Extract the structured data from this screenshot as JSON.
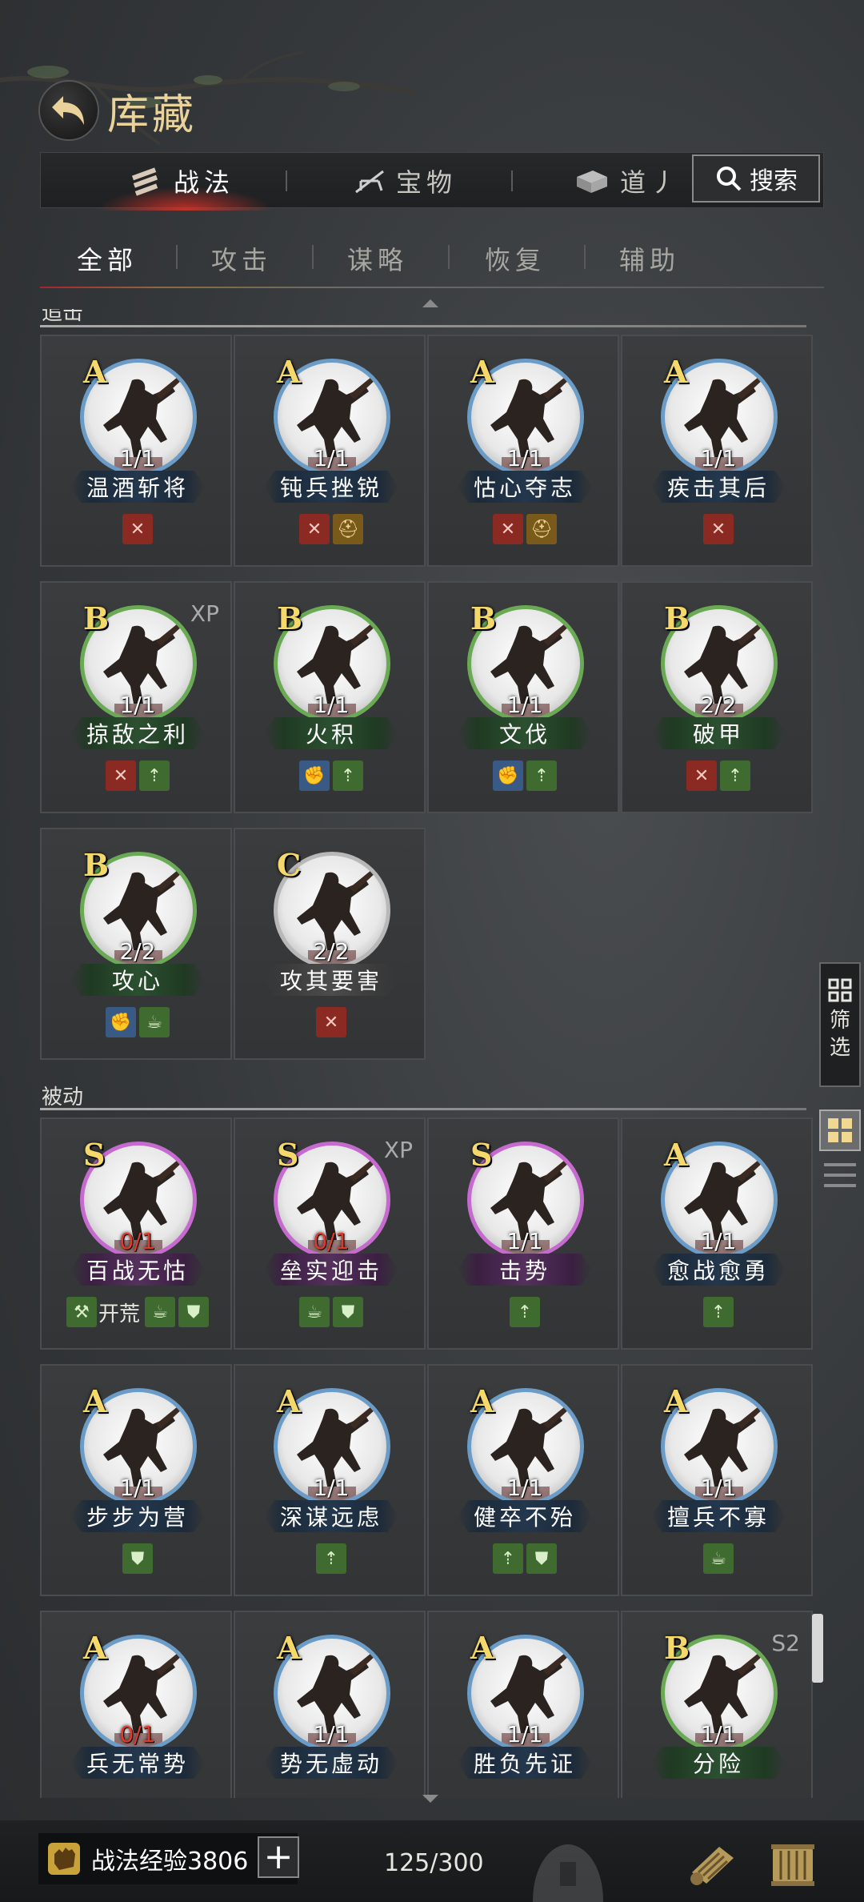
{
  "header": {
    "title": "库藏",
    "back_icon": "back-arrow-icon"
  },
  "top_tabs": [
    {
      "label": "战法",
      "icon": "scroll-icon",
      "active": true
    },
    {
      "label": "宝物",
      "icon": "bow-icon",
      "active": false
    },
    {
      "label": "道丿",
      "icon": "box-icon",
      "active": false
    }
  ],
  "search": {
    "label": "搜索",
    "icon": "search-icon"
  },
  "sub_tabs": [
    {
      "label": "全部",
      "active": true
    },
    {
      "label": "攻击",
      "active": false
    },
    {
      "label": "谋略",
      "active": false
    },
    {
      "label": "恢复",
      "active": false
    },
    {
      "label": "辅助",
      "active": false
    }
  ],
  "sections": [
    {
      "label": "追击",
      "cards": [
        {
          "grade": "A",
          "count": "1/1",
          "name": "温酒斩将",
          "tags": [
            {
              "kind": "red",
              "icon": "crossed-swords-icon"
            }
          ]
        },
        {
          "grade": "A",
          "count": "1/1",
          "name": "钝兵挫锐",
          "tags": [
            {
              "kind": "red",
              "icon": "crossed-swords-icon"
            },
            {
              "kind": "gold",
              "icon": "helmet-icon"
            }
          ]
        },
        {
          "grade": "A",
          "count": "1/1",
          "name": "怙心夺志",
          "tags": [
            {
              "kind": "red",
              "icon": "crossed-swords-icon"
            },
            {
              "kind": "gold",
              "icon": "helmet-icon"
            }
          ]
        },
        {
          "grade": "A",
          "count": "1/1",
          "name": "疾击其后",
          "tags": [
            {
              "kind": "red",
              "icon": "crossed-swords-icon"
            }
          ]
        },
        {
          "grade": "B",
          "count": "1/1",
          "name": "掠敌之利",
          "xp": "XP",
          "tags": [
            {
              "kind": "red",
              "icon": "crossed-swords-icon"
            },
            {
              "kind": "green",
              "icon": "buff-icon"
            }
          ]
        },
        {
          "grade": "B",
          "count": "1/1",
          "name": "火积",
          "tags": [
            {
              "kind": "blue",
              "icon": "fist-icon"
            },
            {
              "kind": "green",
              "icon": "buff-icon"
            }
          ]
        },
        {
          "grade": "B",
          "count": "1/1",
          "name": "文伐",
          "tags": [
            {
              "kind": "blue",
              "icon": "fist-icon"
            },
            {
              "kind": "green",
              "icon": "buff-icon"
            }
          ]
        },
        {
          "grade": "B",
          "count": "2/2",
          "name": "破甲",
          "tags": [
            {
              "kind": "red",
              "icon": "crossed-swords-icon"
            },
            {
              "kind": "green",
              "icon": "buff-icon"
            }
          ]
        },
        {
          "grade": "B",
          "count": "2/2",
          "name": "攻心",
          "tags": [
            {
              "kind": "blue",
              "icon": "fist-icon"
            },
            {
              "kind": "green",
              "icon": "teapot-icon"
            }
          ]
        },
        {
          "grade": "C",
          "count": "2/2",
          "name": "攻其要害",
          "tags": [
            {
              "kind": "red",
              "icon": "crossed-swords-icon"
            }
          ]
        }
      ]
    },
    {
      "label": "被动",
      "cards": [
        {
          "grade": "S",
          "count": "0/1",
          "count_red": true,
          "name": "百战无怙",
          "tags": [
            {
              "kind": "green",
              "icon": "axe-icon",
              "label": "开荒"
            },
            {
              "kind": "green",
              "icon": "teapot-icon"
            },
            {
              "kind": "green",
              "icon": "shield-icon"
            }
          ]
        },
        {
          "grade": "S",
          "count": "0/1",
          "count_red": true,
          "name": "垒实迎击",
          "xp": "XP",
          "tags": [
            {
              "kind": "green",
              "icon": "teapot-icon"
            },
            {
              "kind": "green",
              "icon": "shield-icon"
            }
          ]
        },
        {
          "grade": "S",
          "count": "1/1",
          "name": "击势",
          "tags": [
            {
              "kind": "green",
              "icon": "buff-icon"
            }
          ]
        },
        {
          "grade": "A",
          "count": "1/1",
          "name": "愈战愈勇",
          "tags": [
            {
              "kind": "green",
              "icon": "buff-icon"
            }
          ]
        },
        {
          "grade": "A",
          "count": "1/1",
          "name": "步步为营",
          "tags": [
            {
              "kind": "green",
              "icon": "shield-icon"
            }
          ]
        },
        {
          "grade": "A",
          "count": "1/1",
          "name": "深谋远虑",
          "tags": [
            {
              "kind": "green",
              "icon": "buff-icon"
            }
          ]
        },
        {
          "grade": "A",
          "count": "1/1",
          "name": "健卒不殆",
          "tags": [
            {
              "kind": "green",
              "icon": "buff-icon"
            },
            {
              "kind": "green",
              "icon": "shield-icon"
            }
          ]
        },
        {
          "grade": "A",
          "count": "1/1",
          "name": "擅兵不寡",
          "tags": [
            {
              "kind": "green",
              "icon": "teapot-icon"
            }
          ]
        },
        {
          "grade": "A",
          "count": "0/1",
          "count_red": true,
          "name": "兵无常势",
          "tags": []
        },
        {
          "grade": "A",
          "count": "1/1",
          "name": "势无虚动",
          "tags": []
        },
        {
          "grade": "A",
          "count": "1/1",
          "name": "胜负先证",
          "tags": []
        },
        {
          "grade": "B",
          "count": "1/1",
          "name": "分险",
          "xp": "S2",
          "tags": []
        }
      ]
    }
  ],
  "side": {
    "filter_label": "筛选",
    "filter_icon": "grid-filter-icon",
    "grid_icon": "grid-view-icon",
    "list_icon": "list-view-icon"
  },
  "bottom": {
    "exp_label": "战法经验3806",
    "exp_icon": "exp-fist-icon",
    "plus_label": "+",
    "capacity": "125/300",
    "icons": [
      "helmet-watermark-icon",
      "scroll-exchange-icon",
      "bamboo-slips-icon"
    ]
  },
  "colors": {
    "grade_S": "#c66ad0",
    "grade_A": "#6a9cc7",
    "grade_B": "#6aaa54",
    "grade_C": "#b8b8b8",
    "gold_text": "#f5d86a",
    "red_count": "#e03a2a"
  }
}
